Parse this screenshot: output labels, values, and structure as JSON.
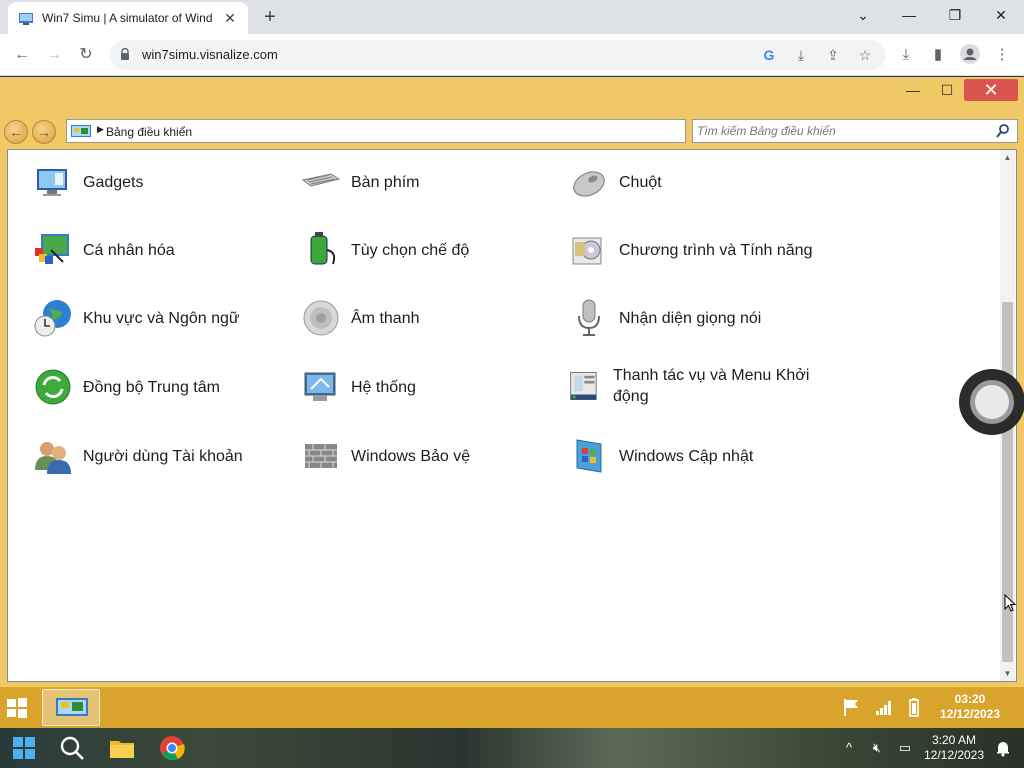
{
  "browser": {
    "tab_title": "Win7 Simu | A simulator of Wind",
    "tab_close": "✕",
    "new_tab": "+",
    "url": "win7simu.visnalize.com",
    "window_minimize": "—",
    "window_restore": "❐",
    "window_close": "✕"
  },
  "win7_window": {
    "minimize": "—",
    "maximize": "☐",
    "close": "✕",
    "breadcrumb": "Bảng điều khiển",
    "search_placeholder": "Tìm kiếm Bảng điều khiển",
    "items": [
      {
        "label": "Gadgets",
        "icon": "gadgets-icon"
      },
      {
        "label": "Bàn phím",
        "icon": "keyboard-icon"
      },
      {
        "label": "Chuột",
        "icon": "mouse-icon"
      },
      {
        "label": "Cá nhân hóa",
        "icon": "personalization-icon"
      },
      {
        "label": "Tùy chọn chế độ",
        "icon": "power-options-icon"
      },
      {
        "label": "Chương trình và Tính năng",
        "icon": "programs-features-icon"
      },
      {
        "label": "Khu vực và Ngôn ngữ",
        "icon": "region-language-icon"
      },
      {
        "label": "Âm thanh",
        "icon": "sound-icon"
      },
      {
        "label": "Nhận diện giọng nói",
        "icon": "speech-recognition-icon"
      },
      {
        "label": "Đồng bộ Trung tâm",
        "icon": "sync-center-icon"
      },
      {
        "label": "Hệ thống",
        "icon": "system-icon"
      },
      {
        "label": "Thanh tác vụ và Menu Khởi động",
        "icon": "taskbar-start-menu-icon"
      },
      {
        "label": "Người dùng Tài khoản",
        "icon": "user-accounts-icon"
      },
      {
        "label": "Windows Bảo vệ",
        "icon": "windows-defender-icon"
      },
      {
        "label": "Windows Cập nhật",
        "icon": "windows-update-icon"
      }
    ]
  },
  "win7_taskbar": {
    "time": "03:20",
    "date": "12/12/2023"
  },
  "os_taskbar": {
    "time": "3:20 AM",
    "date": "12/12/2023",
    "tray_chevron": "^"
  },
  "colors": {
    "win7_window_bg": "#f0c865",
    "win7_taskbar_bg": "#d8a42c",
    "close_red": "#d9534f"
  }
}
